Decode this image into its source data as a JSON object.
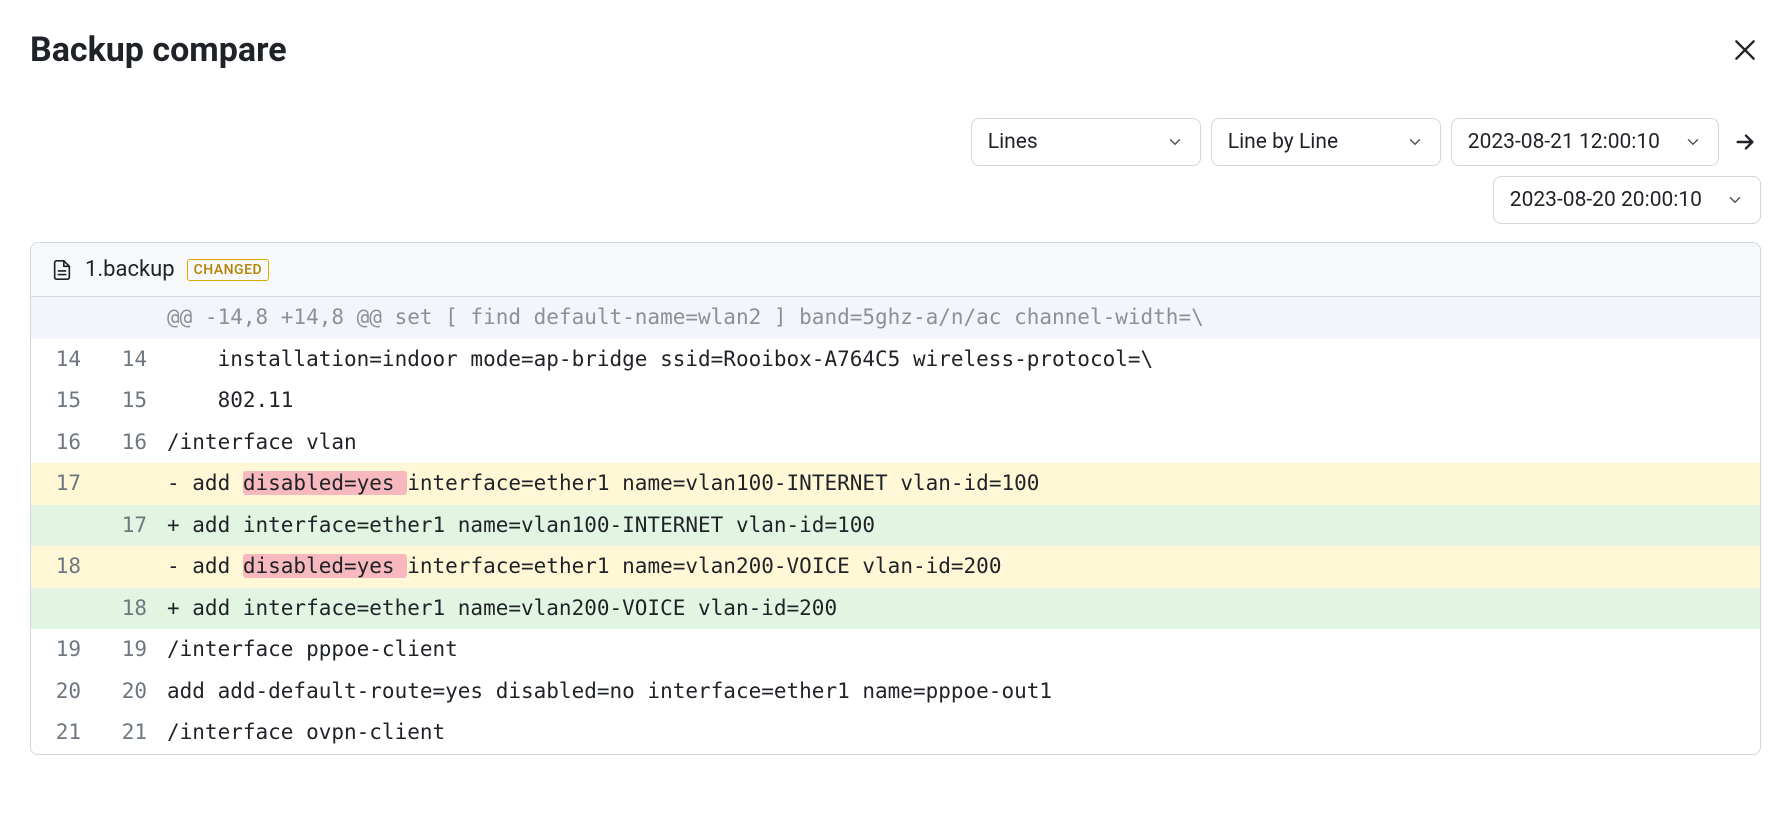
{
  "header": {
    "title": "Backup compare"
  },
  "controls": {
    "mode": "Lines",
    "view": "Line by Line",
    "datetime_a": "2023-08-21 12:00:10",
    "datetime_b": "2023-08-20 20:00:10"
  },
  "file": {
    "name": "1.backup",
    "badge": "CHANGED"
  },
  "diff": {
    "hunk": "@@ -14,8 +14,8 @@ set [ find default-name=wlan2 ] band=5ghz-a/n/ac channel-width=\\",
    "rows": [
      {
        "type": "ctx",
        "a": "14",
        "b": "14",
        "text": "    installation=indoor mode=ap-bridge ssid=Rooibox-A764C5 wireless-protocol=\\"
      },
      {
        "type": "ctx",
        "a": "15",
        "b": "15",
        "text": "    802.11"
      },
      {
        "type": "ctx",
        "a": "16",
        "b": "16",
        "text": "/interface vlan"
      },
      {
        "type": "del",
        "a": "17",
        "b": "",
        "prefix": "- add ",
        "intra": "disabled=yes ",
        "suffix": "interface=ether1 name=vlan100-INTERNET vlan-id=100"
      },
      {
        "type": "add",
        "a": "",
        "b": "17",
        "text": "+ add interface=ether1 name=vlan100-INTERNET vlan-id=100"
      },
      {
        "type": "del",
        "a": "18",
        "b": "",
        "prefix": "- add ",
        "intra": "disabled=yes ",
        "suffix": "interface=ether1 name=vlan200-VOICE vlan-id=200"
      },
      {
        "type": "add",
        "a": "",
        "b": "18",
        "text": "+ add interface=ether1 name=vlan200-VOICE vlan-id=200"
      },
      {
        "type": "ctx",
        "a": "19",
        "b": "19",
        "text": "/interface pppoe-client"
      },
      {
        "type": "ctx",
        "a": "20",
        "b": "20",
        "text": "add add-default-route=yes disabled=no interface=ether1 name=pppoe-out1"
      },
      {
        "type": "ctx",
        "a": "21",
        "b": "21",
        "text": "/interface ovpn-client"
      }
    ]
  }
}
